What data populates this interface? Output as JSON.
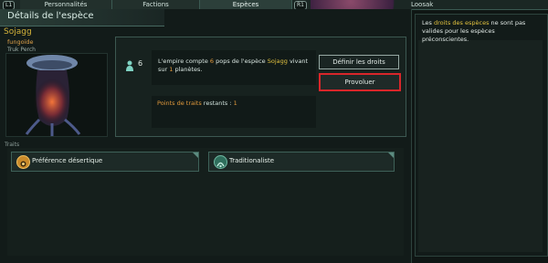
{
  "tabs": {
    "left_key": "L1",
    "personnalites": "Personnalités",
    "factions": "Factions",
    "especes": "Espèces",
    "right_key": "R1",
    "leader": "Loosak"
  },
  "window": {
    "title": "Détails de l'espèce"
  },
  "species": {
    "name": "Sojagg",
    "class": "fungoïde",
    "homeworld": "Truk Perch"
  },
  "population": {
    "count": "6",
    "desc_prefix": "L'empire compte ",
    "desc_pops": "6",
    "desc_mid": " pops de l'espèce ",
    "desc_species": "Sojagg",
    "desc_mid2": " vivant sur ",
    "desc_planets": "1",
    "desc_suffix": " planètes."
  },
  "buttons": {
    "define_rights": "Définir les droits",
    "uplift": "Provoluer"
  },
  "trait_points": {
    "label": "Points de traits",
    "rest": " restants : ",
    "value": "1"
  },
  "traits": {
    "label": "Traits",
    "items": [
      {
        "label": "Préférence désertique",
        "icon": "desert-preference-icon"
      },
      {
        "label": "Traditionaliste",
        "icon": "traditionalist-icon"
      }
    ]
  },
  "info": {
    "prefix": "Les ",
    "highlight": "droits des espèces",
    "suffix": " ne sont pas valides pour les espèces préconscientes."
  },
  "colors": {
    "highlight": "#e1c13f",
    "orange": "#e39a3c",
    "uplift_border": "#d9262a"
  }
}
